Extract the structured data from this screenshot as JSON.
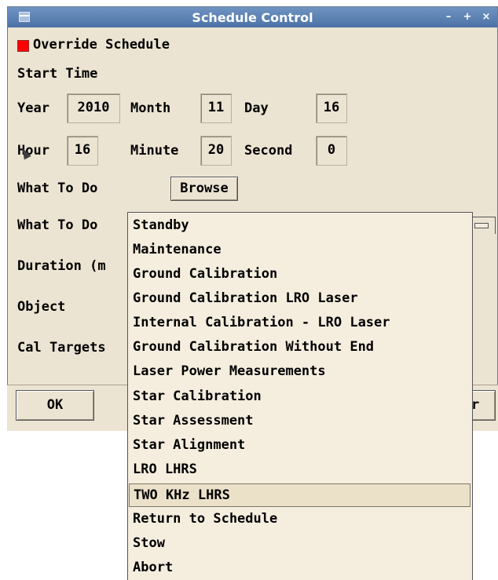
{
  "window": {
    "title": "Schedule Control"
  },
  "override_label": "Override Schedule",
  "start_time_label": "Start Time",
  "fields": {
    "year": {
      "label": "Year",
      "value": "2010"
    },
    "month": {
      "label": "Month",
      "value": "11"
    },
    "day": {
      "label": "Day",
      "value": "16"
    },
    "hour": {
      "label": "Hour",
      "value": "16"
    },
    "minute": {
      "label": "Minute",
      "value": "20"
    },
    "second": {
      "label": "Second",
      "value": "0"
    }
  },
  "what_to_do_label": "What To Do",
  "browse_label": "Browse",
  "duration_label": "Duration (m",
  "object_label": "Object",
  "cal_targets_label": "Cal Targets",
  "ok_label": "OK",
  "partial_button_label": "r",
  "dropdown": {
    "items": [
      "Standby",
      "Maintenance",
      "Ground Calibration",
      "Ground Calibration LRO Laser",
      "Internal Calibration - LRO Laser",
      "Ground Calibration Without End",
      "Laser Power Measurements",
      "Star Calibration",
      "Star Assessment",
      "Star Alignment",
      "LRO LHRS",
      "TWO KHz LHRS",
      "Return to Schedule",
      "Stow",
      "Abort"
    ],
    "selected": "TWO KHz LHRS"
  },
  "colors": {
    "titlebar": "#5a7fb3",
    "window_bg": "#ece4d2",
    "checkbox": "#ff0000"
  },
  "icons": [
    "window-menu-icon",
    "minimize-icon",
    "maximize-icon",
    "close-icon",
    "dropdown-arrow-icon",
    "mouse-cursor-icon"
  ]
}
